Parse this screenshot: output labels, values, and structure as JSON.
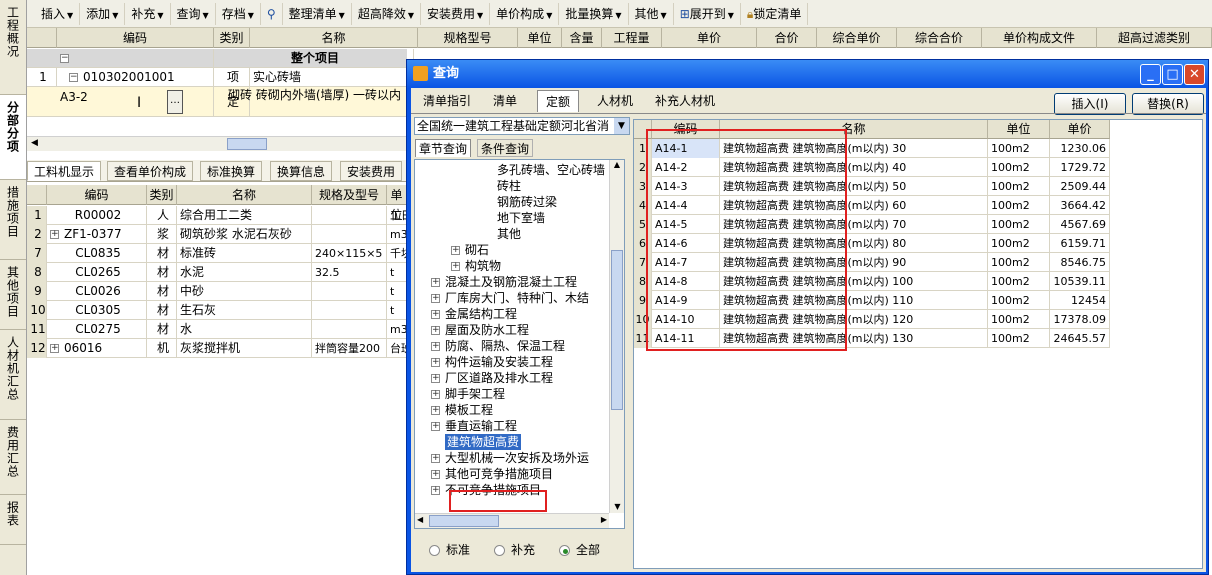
{
  "vtabs": [
    "工程概况",
    "分部分项",
    "措施项目",
    "其他项目",
    "人材机汇总",
    "费用汇总",
    "报表"
  ],
  "toolbar": [
    "插入",
    "添加",
    "补充",
    "查询",
    "存档",
    "整理清单",
    "超高降效",
    "安装费用",
    "单价构成",
    "批量换算",
    "其他",
    "展开到",
    "锁定清单"
  ],
  "main_grid": {
    "headers": [
      "编码",
      "类别",
      "名称",
      "规格型号",
      "单位",
      "含量",
      "工程量",
      "单价",
      "合价",
      "综合单价",
      "综合合价",
      "单价构成文件",
      "超高过滤类别"
    ],
    "section_label": "整个项目",
    "rows": [
      {
        "num": "1",
        "code": "010302001001",
        "type": "项",
        "name": "实心砖墙"
      },
      {
        "num": "",
        "code": "A3-2",
        "type": "定",
        "name": "砌砖 砖砌内外墙(墙厚) 一砖以内"
      }
    ]
  },
  "sub_tabs": [
    "工料机显示",
    "查看单价构成",
    "标准换算",
    "换算信息",
    "安装费用"
  ],
  "sub_grid": {
    "headers": [
      "编码",
      "类别",
      "名称",
      "规格及型号",
      "单位"
    ],
    "rows": [
      {
        "num": "1",
        "code": "R00002",
        "type": "人",
        "name": "综合用工二类",
        "spec": "",
        "unit": "工日"
      },
      {
        "num": "2",
        "code": "ZF1-0377",
        "type": "浆",
        "name": "砌筑砂浆 水泥石灰砂",
        "spec": "",
        "unit": "m3"
      },
      {
        "num": "7",
        "code": "CL0835",
        "type": "材",
        "name": "标准砖",
        "spec": "240×115×5",
        "unit": "千块"
      },
      {
        "num": "8",
        "code": "CL0265",
        "type": "材",
        "name": "水泥",
        "spec": "32.5",
        "unit": "t"
      },
      {
        "num": "9",
        "code": "CL0026",
        "type": "材",
        "name": "中砂",
        "spec": "",
        "unit": "t"
      },
      {
        "num": "10",
        "code": "CL0305",
        "type": "材",
        "name": "生石灰",
        "spec": "",
        "unit": "t"
      },
      {
        "num": "11",
        "code": "CL0275",
        "type": "材",
        "name": "水",
        "spec": "",
        "unit": "m3"
      },
      {
        "num": "12",
        "code": "06016",
        "type": "机",
        "name": "灰浆搅拌机",
        "spec": "拌筒容量200",
        "unit": "台班"
      }
    ]
  },
  "dialog": {
    "title": "查询",
    "tabs": [
      "清单指引",
      "清单",
      "定额",
      "人材机",
      "补充人材机"
    ],
    "insert_btn": "插入(I)",
    "replace_btn": "替换(R)",
    "library": "全国统一建筑工程基础定额河北省消",
    "tree_tabs": [
      "章节查询",
      "条件查询"
    ],
    "tree_items": [
      {
        "label": "多孔砖墙、空心砖墙",
        "expander": false,
        "indent": 3
      },
      {
        "label": "砖柱",
        "expander": false,
        "indent": 3
      },
      {
        "label": "钢筋砖过梁",
        "expander": false,
        "indent": 3
      },
      {
        "label": "地下室墙",
        "expander": false,
        "indent": 3
      },
      {
        "label": "其他",
        "expander": false,
        "indent": 3
      },
      {
        "label": "砌石",
        "expander": true,
        "indent": 2
      },
      {
        "label": "构筑物",
        "expander": true,
        "indent": 2
      },
      {
        "label": "混凝土及钢筋混凝土工程",
        "expander": true,
        "indent": 1
      },
      {
        "label": "厂库房大门、特种门、木结",
        "expander": true,
        "indent": 1
      },
      {
        "label": "金属结构工程",
        "expander": true,
        "indent": 1
      },
      {
        "label": "屋面及防水工程",
        "expander": true,
        "indent": 1
      },
      {
        "label": "防腐、隔热、保温工程",
        "expander": true,
        "indent": 1
      },
      {
        "label": "构件运输及安装工程",
        "expander": true,
        "indent": 1
      },
      {
        "label": "厂区道路及排水工程",
        "expander": true,
        "indent": 1
      },
      {
        "label": "脚手架工程",
        "expander": true,
        "indent": 1
      },
      {
        "label": "模板工程",
        "expander": true,
        "indent": 1
      },
      {
        "label": "垂直运输工程",
        "expander": true,
        "indent": 1
      },
      {
        "label": "建筑物超高费",
        "expander": false,
        "indent": 1,
        "selected": true
      },
      {
        "label": "大型机械一次安拆及场外运",
        "expander": true,
        "indent": 1
      },
      {
        "label": "其他可竞争措施项目",
        "expander": true,
        "indent": 1
      },
      {
        "label": "不可竞争措施项目",
        "expander": true,
        "indent": 1
      }
    ],
    "radios": [
      "标准",
      "补充",
      "全部"
    ],
    "radio_selected": "全部",
    "result_headers": [
      "编码",
      "名称",
      "单位",
      "单价"
    ],
    "results": [
      {
        "num": "1",
        "code": "A14-1",
        "name": "建筑物超高费 建筑物高度(m以内) 30",
        "unit": "100m2",
        "price": "1230.06"
      },
      {
        "num": "2",
        "code": "A14-2",
        "name": "建筑物超高费 建筑物高度(m以内) 40",
        "unit": "100m2",
        "price": "1729.72"
      },
      {
        "num": "3",
        "code": "A14-3",
        "name": "建筑物超高费 建筑物高度(m以内) 50",
        "unit": "100m2",
        "price": "2509.44"
      },
      {
        "num": "4",
        "code": "A14-4",
        "name": "建筑物超高费 建筑物高度(m以内) 60",
        "unit": "100m2",
        "price": "3664.42"
      },
      {
        "num": "5",
        "code": "A14-5",
        "name": "建筑物超高费 建筑物高度(m以内) 70",
        "unit": "100m2",
        "price": "4567.69"
      },
      {
        "num": "6",
        "code": "A14-6",
        "name": "建筑物超高费 建筑物高度(m以内) 80",
        "unit": "100m2",
        "price": "6159.71"
      },
      {
        "num": "7",
        "code": "A14-7",
        "name": "建筑物超高费 建筑物高度(m以内) 90",
        "unit": "100m2",
        "price": "8546.75"
      },
      {
        "num": "8",
        "code": "A14-8",
        "name": "建筑物超高费 建筑物高度(m以内) 100",
        "unit": "100m2",
        "price": "10539.11"
      },
      {
        "num": "9",
        "code": "A14-9",
        "name": "建筑物超高费 建筑物高度(m以内) 110",
        "unit": "100m2",
        "price": "12454"
      },
      {
        "num": "10",
        "code": "A14-10",
        "name": "建筑物超高费 建筑物高度(m以内) 120",
        "unit": "100m2",
        "price": "17378.09"
      },
      {
        "num": "11",
        "code": "A14-11",
        "name": "建筑物超高费 建筑物高度(m以内) 130",
        "unit": "100m2",
        "price": "24645.57"
      }
    ]
  }
}
